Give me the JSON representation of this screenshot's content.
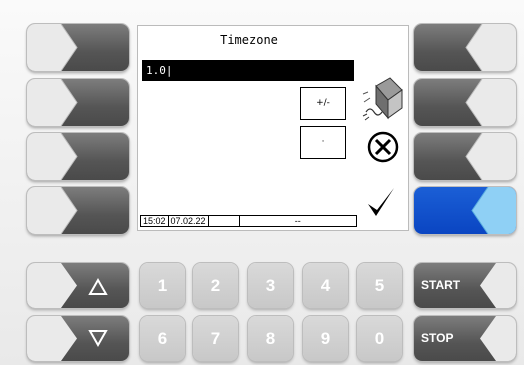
{
  "screen": {
    "title": "Timezone",
    "input_value": "1.0|",
    "keys": {
      "plus_minus": "+/-",
      "dot": "·"
    },
    "status": {
      "time": "15:02",
      "date": "07.02.22",
      "field3": "",
      "field4": "--"
    }
  },
  "numpad": {
    "top_row": [
      "1",
      "2",
      "3",
      "4",
      "5"
    ],
    "bottom_row": [
      "6",
      "7",
      "8",
      "9",
      "0"
    ]
  },
  "controls": {
    "start_label": "START",
    "stop_label": "STOP"
  },
  "icons": {
    "eraser": "eraser-icon",
    "cancel": "cancel-x-icon",
    "confirm": "checkmark-icon",
    "up": "up-triangle-icon",
    "down": "down-triangle-icon"
  },
  "colors": {
    "active_softkey": "#0a45c2",
    "softkey_gray": "#555555"
  }
}
